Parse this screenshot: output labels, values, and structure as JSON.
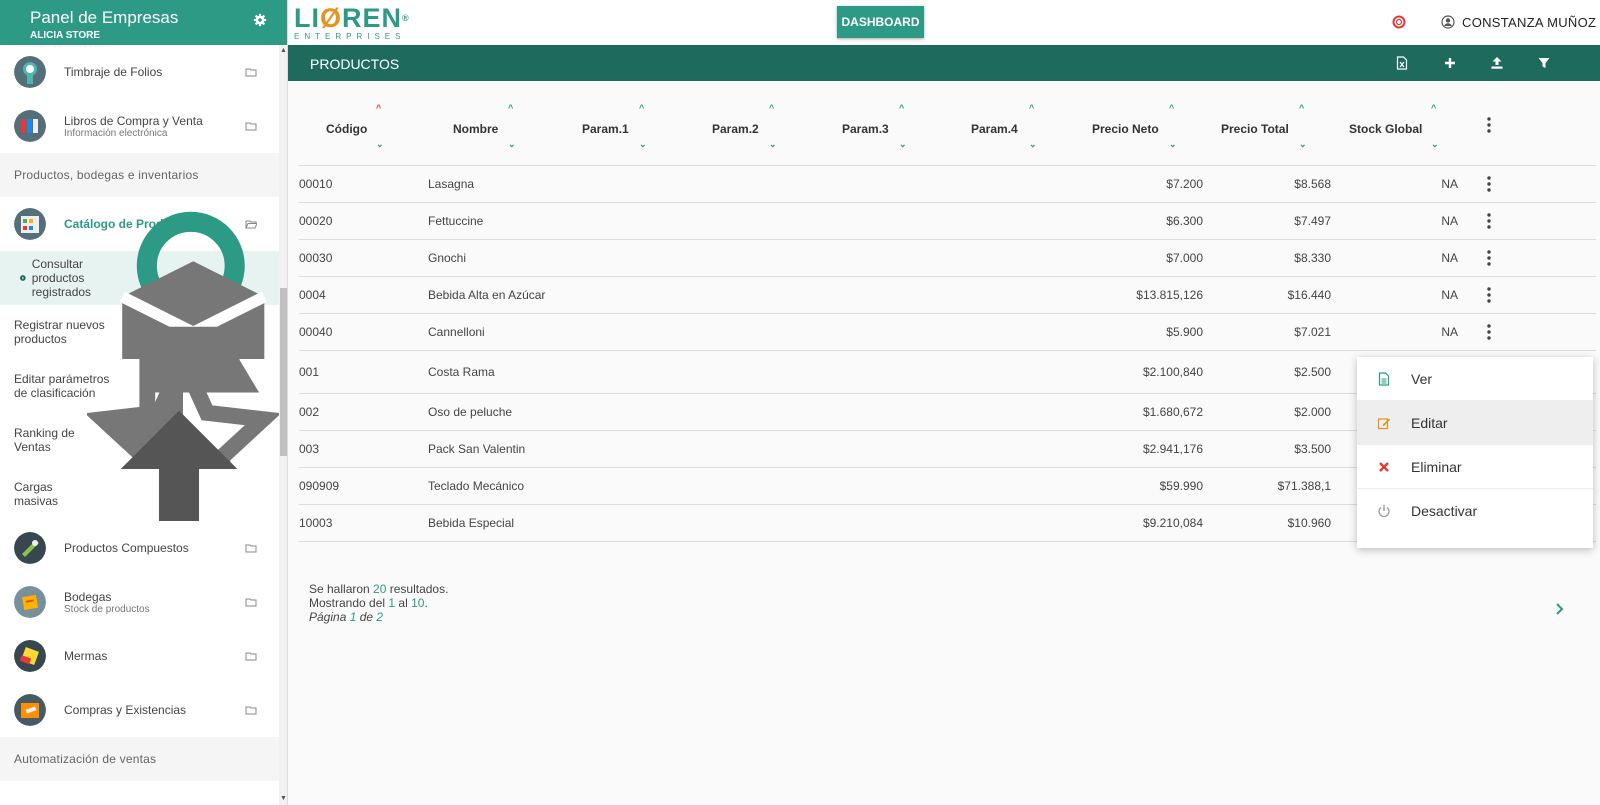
{
  "sidebar": {
    "title": "Panel de Empresas",
    "subtitle": "ALICIA STORE",
    "items": [
      {
        "label": "Timbraje de Folios",
        "sub": ""
      },
      {
        "label": "Libros de Compra y Venta",
        "sub": "Información electrónica"
      }
    ],
    "section1": "Productos, bodegas e inventarios",
    "catalog": {
      "label": "Catálogo de Productos"
    },
    "subitems": [
      "Consultar productos registrados",
      "Registrar nuevos productos",
      "Editar parámetros de clasificación",
      "Ranking de Ventas",
      "Cargas masivas"
    ],
    "items2": [
      {
        "label": "Productos Compuestos",
        "sub": ""
      },
      {
        "label": "Bodegas",
        "sub": "Stock de productos"
      },
      {
        "label": "Mermas",
        "sub": ""
      },
      {
        "label": "Compras y Existencias",
        "sub": ""
      }
    ],
    "section2": "Automatización de ventas"
  },
  "topbar": {
    "logo_main_a": "LI",
    "logo_main_o": "Ø",
    "logo_main_b": "REN",
    "logo_reg": "®",
    "logo_sub": "ENTERPRISES",
    "dashboard_label": "DASHBOARD",
    "user_name": "CONSTANZA MUÑOZ"
  },
  "titlebar": {
    "title": "PRODUCTOS"
  },
  "table": {
    "columns": [
      "Código",
      "Nombre",
      "Param.1",
      "Param.2",
      "Param.3",
      "Param.4",
      "Precio Neto",
      "Precio Total",
      "Stock Global"
    ],
    "rows": [
      {
        "code": "00010",
        "name": "Lasagna",
        "neto": "$7.200",
        "total": "$8.568",
        "stock": "NA"
      },
      {
        "code": "00020",
        "name": "Fettuccine",
        "neto": "$6.300",
        "total": "$7.497",
        "stock": "NA"
      },
      {
        "code": "00030",
        "name": "Gnochi",
        "neto": "$7.000",
        "total": "$8.330",
        "stock": "NA"
      },
      {
        "code": "0004",
        "name": "Bebida Alta en Azúcar",
        "neto": "$13.815,126",
        "total": "$16.440",
        "stock": "NA"
      },
      {
        "code": "00040",
        "name": "Cannelloni",
        "neto": "$5.900",
        "total": "$7.021",
        "stock": "NA"
      },
      {
        "code": "001",
        "name": "Costa Rama",
        "neto": "$2.100,840",
        "total": "$2.500",
        "stock": ""
      },
      {
        "code": "002",
        "name": "Oso de peluche",
        "neto": "$1.680,672",
        "total": "$2.000",
        "stock": ""
      },
      {
        "code": "003",
        "name": "Pack San Valentin",
        "neto": "$2.941,176",
        "total": "$3.500",
        "stock": ""
      },
      {
        "code": "090909",
        "name": "Teclado Mecánico",
        "neto": "$59.990",
        "total": "$71.388,1",
        "stock": ""
      },
      {
        "code": "10003",
        "name": "Bebida Especial",
        "neto": "$9.210,084",
        "total": "$10.960",
        "stock": ""
      }
    ]
  },
  "footer": {
    "found_pre": "Se hallaron ",
    "found_num": "20",
    "found_post": " resultados.",
    "show_pre": "Mostrando del ",
    "show_from": "1",
    "show_mid": " al ",
    "show_to": "10",
    "show_post": ".",
    "page_pre": "Página ",
    "page_num": "1",
    "page_mid": " de ",
    "page_total": "2"
  },
  "menu": {
    "items": [
      "Ver",
      "Editar",
      "Eliminar",
      "Desactivar"
    ]
  },
  "colors": {
    "brand": "#2c9a85",
    "title_bar": "#1e6b5d",
    "accent_orange": "#e8931e",
    "delete_red": "#e53935"
  }
}
